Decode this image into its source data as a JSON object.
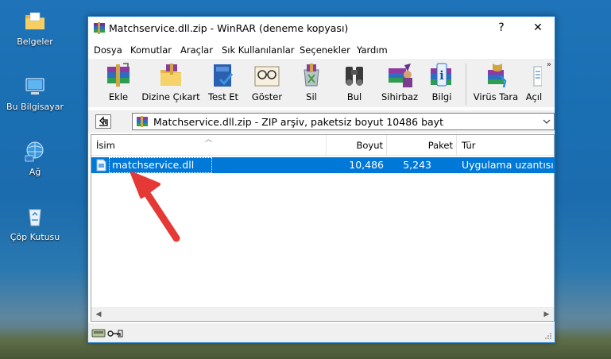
{
  "desktop": {
    "icons": [
      {
        "label": "Belgeler",
        "icon": "documents-folder-icon"
      },
      {
        "label": "Bu Bilgisayar",
        "icon": "computer-icon"
      },
      {
        "label": "Ağ",
        "icon": "network-icon"
      },
      {
        "label": "Çöp Kutusu",
        "icon": "recycle-bin-icon"
      }
    ]
  },
  "window": {
    "title": "Matchservice.dll.zip - WinRAR (deneme kopyası)",
    "help_btn": "?",
    "close_btn": "✕",
    "menu": [
      "Dosya",
      "Komutlar",
      "Araçlar",
      "Sık Kullanılanlar",
      "Seçenekler",
      "Yardım"
    ],
    "toolbar": [
      {
        "label": "Ekle",
        "icon": "add-archive-icon"
      },
      {
        "label": "Dizine Çıkart",
        "icon": "extract-to-icon"
      },
      {
        "label": "Test Et",
        "icon": "test-icon"
      },
      {
        "label": "Göster",
        "icon": "view-icon"
      },
      {
        "label": "Sil",
        "icon": "delete-icon"
      },
      {
        "label": "Bul",
        "icon": "find-icon"
      },
      {
        "label": "Sihirbaz",
        "icon": "wizard-icon"
      },
      {
        "label": "Bilgi",
        "icon": "info-icon"
      },
      {
        "label": "Virüs Tara",
        "icon": "virus-scan-icon"
      },
      {
        "label": "Açıl",
        "icon": "comment-icon"
      }
    ],
    "toolbar_more": "»",
    "address": {
      "path": "Matchservice.dll.zip - ZIP arşiv, paketsiz boyut 10486 bayt"
    },
    "columns": [
      "İsim",
      "Boyut",
      "Paket",
      "Tür"
    ],
    "rows": [
      {
        "name": "matchservice.dll",
        "size": "10,486",
        "packed": "5,243",
        "type": "Uygulama uzantısı"
      }
    ],
    "colors": {
      "selection": "#0078d7",
      "window_border": "#1979ca",
      "pointer_arrow": "#e53935"
    }
  }
}
